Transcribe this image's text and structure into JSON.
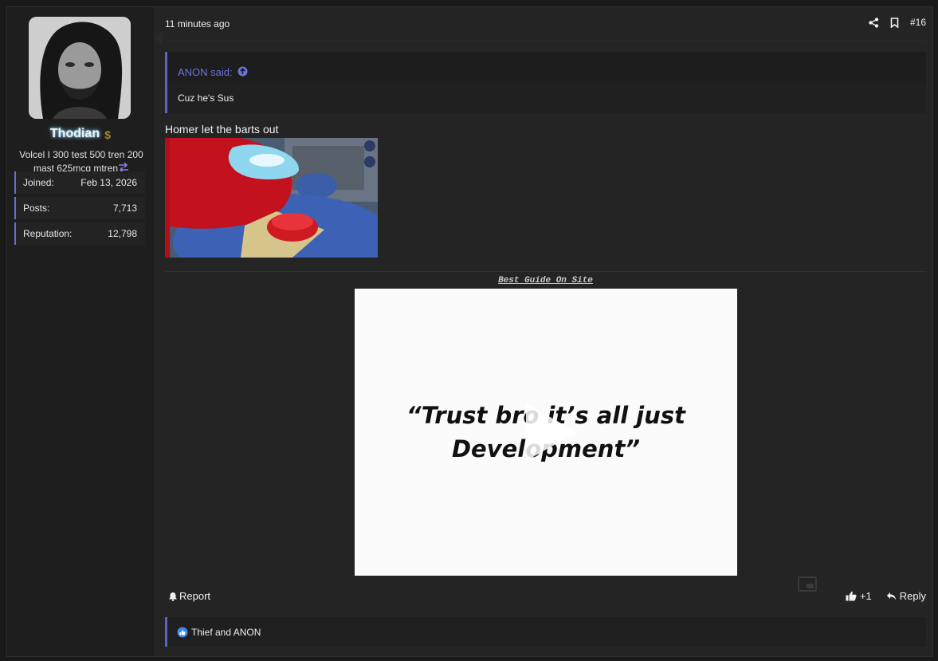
{
  "user": {
    "name": "Thodian",
    "title": "Volcel I 300 test 500 tren 200 mast 625mcg mtren",
    "stats": [
      {
        "label": "Joined:",
        "value": "Feb 13, 2026"
      },
      {
        "label": "Posts:",
        "value": "7,713"
      },
      {
        "label": "Reputation:",
        "value": "12,798"
      }
    ]
  },
  "post": {
    "timestamp": "11 minutes ago",
    "number": "#16",
    "quote": {
      "author": "ANON said:",
      "text": "Cuz he's Sus"
    },
    "text": "Homer let the barts out",
    "signature_link": "Best Guide On Site",
    "video_text": "“Trust bro it’s all just Development”"
  },
  "actions": {
    "report": "Report",
    "like_count": "+1",
    "reply": "Reply"
  },
  "reactions": {
    "text": "Thief and ANON"
  },
  "icons": [
    "dollar-icon",
    "swap-icon",
    "share-icon",
    "bookmark-icon",
    "arrow-up-circle-icon",
    "play-icon",
    "bell-icon",
    "thumbs-up-icon",
    "reply-icon",
    "like-reaction-icon",
    "picture-in-picture-icon"
  ],
  "colors": {
    "accent": "#5c63c8",
    "quote_link": "#6b73d9",
    "background": "#242424"
  }
}
